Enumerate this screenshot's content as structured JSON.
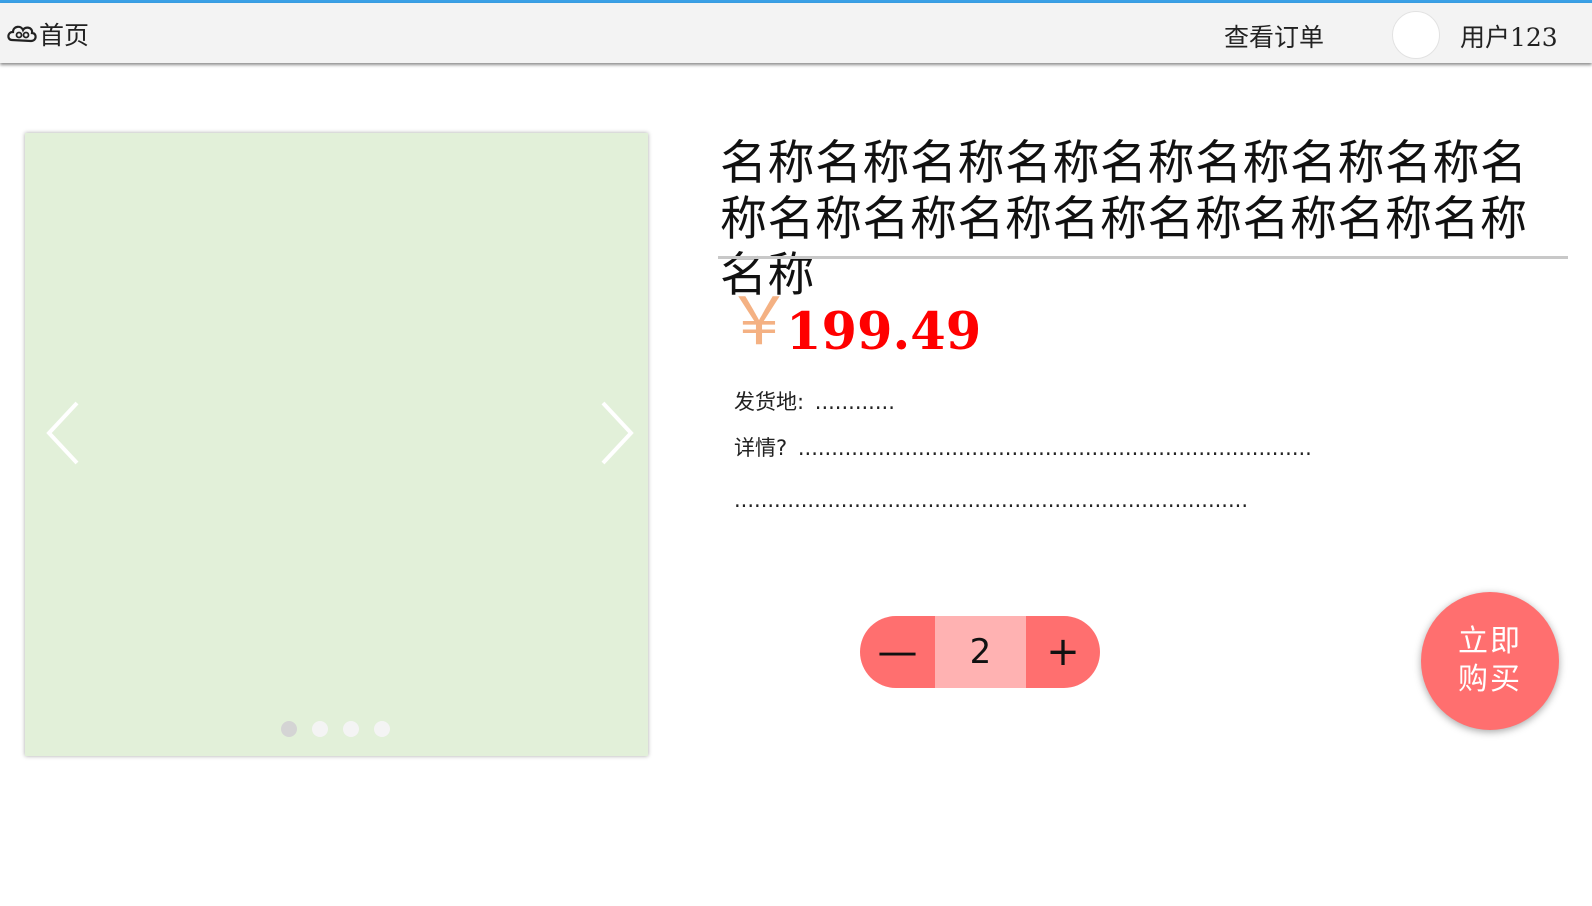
{
  "nav": {
    "home_label": "首页",
    "orders_label": "查看订单",
    "user_label": "用户123",
    "accent_color": "#3aa0e6"
  },
  "product": {
    "title": "名称名称名称名称名称名称名称名称名称名称名称名称名称名称名称名称名称名称",
    "currency_symbol": "￥",
    "price": "199.49",
    "ship_label": "发货地:",
    "ship_value": "............",
    "detail_label": "详情?",
    "detail_value": ".............................................................................",
    "detail_value_2": ".............................................................................",
    "price_color": "#ff0000"
  },
  "carousel": {
    "background_color": "#e2f0d9",
    "slide_count": 4,
    "active_index": 0,
    "prev_icon": "chevron-left-icon",
    "next_icon": "chevron-right-icon"
  },
  "purchase": {
    "minus_label": "—",
    "plus_label": "+",
    "quantity": "2",
    "buy_label": "立即购买",
    "button_color": "#ff6f6f"
  }
}
